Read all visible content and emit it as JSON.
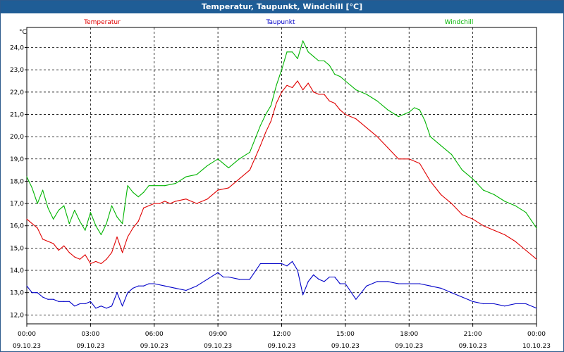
{
  "window": {
    "title": "Temperatur, Taupunkt, Windchill [°C]"
  },
  "chart_data": {
    "type": "line",
    "title": "Temperatur, Taupunkt, Windchill [°C]",
    "ylabel": "°C",
    "xlabel": "",
    "ylim": [
      11.6,
      24.9
    ],
    "y_ticks": [
      "12,0",
      "13,0",
      "14,0",
      "15,0",
      "16,0",
      "17,0",
      "18,0",
      "19,0",
      "20,0",
      "21,0",
      "22,0",
      "23,0",
      "24,0"
    ],
    "x_ticks": [
      {
        "time": "00:00",
        "date": "09.10.23"
      },
      {
        "time": "03:00",
        "date": "09.10.23"
      },
      {
        "time": "06:00",
        "date": "09.10.23"
      },
      {
        "time": "09:00",
        "date": "09.10.23"
      },
      {
        "time": "12:00",
        "date": "09.10.23"
      },
      {
        "time": "15:00",
        "date": "09.10.23"
      },
      {
        "time": "18:00",
        "date": "09.10.23"
      },
      {
        "time": "21:00",
        "date": "09.10.23"
      },
      {
        "time": "00:00",
        "date": "10.10.23"
      }
    ],
    "grid": true,
    "legend": "top",
    "x_unit": "hours",
    "series": [
      {
        "name": "Temperatur",
        "color": "#e00000",
        "x": [
          0,
          0.25,
          0.5,
          0.75,
          1,
          1.25,
          1.5,
          1.75,
          2,
          2.25,
          2.5,
          2.75,
          3,
          3.25,
          3.5,
          3.75,
          4,
          4.25,
          4.5,
          4.75,
          5,
          5.25,
          5.5,
          5.75,
          6,
          6.25,
          6.5,
          6.75,
          7,
          7.5,
          8,
          8.5,
          9,
          9.5,
          10,
          10.5,
          11,
          11.25,
          11.5,
          11.75,
          12,
          12.25,
          12.5,
          12.75,
          13,
          13.25,
          13.5,
          13.75,
          14,
          14.25,
          14.5,
          14.75,
          15,
          15.5,
          16,
          16.5,
          17,
          17.5,
          18,
          18.5,
          19,
          19.5,
          20,
          20.5,
          21,
          21.5,
          22,
          22.5,
          23,
          23.5,
          24
        ],
        "values": [
          16.3,
          16.1,
          15.9,
          15.4,
          15.3,
          15.2,
          14.9,
          15.1,
          14.8,
          14.6,
          14.5,
          14.7,
          14.3,
          14.4,
          14.3,
          14.5,
          14.8,
          15.5,
          14.8,
          15.5,
          15.9,
          16.2,
          16.8,
          16.9,
          17.0,
          17.0,
          17.1,
          17.0,
          17.1,
          17.2,
          17.0,
          17.2,
          17.6,
          17.7,
          18.1,
          18.5,
          19.6,
          20.2,
          20.7,
          21.5,
          22.0,
          22.3,
          22.2,
          22.5,
          22.1,
          22.4,
          22.0,
          21.9,
          21.9,
          21.6,
          21.5,
          21.2,
          21.0,
          20.8,
          20.4,
          20.0,
          19.5,
          19.0,
          19.0,
          18.8,
          18.0,
          17.4,
          17.0,
          16.5,
          16.3,
          16.0,
          15.8,
          15.6,
          15.3,
          14.9,
          14.5
        ]
      },
      {
        "name": "Taupunkt",
        "color": "#0000c8",
        "x": [
          0,
          0.25,
          0.5,
          0.75,
          1,
          1.25,
          1.5,
          1.75,
          2,
          2.25,
          2.5,
          2.75,
          3,
          3.25,
          3.5,
          3.75,
          4,
          4.25,
          4.5,
          4.75,
          5,
          5.25,
          5.5,
          5.75,
          6,
          6.5,
          7,
          7.5,
          8,
          8.5,
          9,
          9.25,
          9.5,
          10,
          10.5,
          11,
          11.5,
          12,
          12.25,
          12.5,
          12.75,
          13,
          13.25,
          13.5,
          13.75,
          14,
          14.25,
          14.5,
          14.75,
          15,
          15.5,
          16,
          16.5,
          17,
          17.5,
          18,
          18.5,
          19,
          19.5,
          20,
          20.5,
          21,
          21.5,
          22,
          22.5,
          23,
          23.5,
          24
        ],
        "values": [
          13.3,
          13.0,
          13.0,
          12.8,
          12.7,
          12.7,
          12.6,
          12.6,
          12.6,
          12.4,
          12.5,
          12.5,
          12.6,
          12.3,
          12.4,
          12.3,
          12.4,
          13.0,
          12.4,
          13.0,
          13.2,
          13.3,
          13.3,
          13.4,
          13.4,
          13.3,
          13.2,
          13.1,
          13.3,
          13.6,
          13.9,
          13.7,
          13.7,
          13.6,
          13.6,
          14.3,
          14.3,
          14.3,
          14.2,
          14.4,
          14.0,
          12.9,
          13.5,
          13.8,
          13.6,
          13.5,
          13.7,
          13.7,
          13.4,
          13.4,
          12.7,
          13.3,
          13.5,
          13.5,
          13.4,
          13.4,
          13.4,
          13.3,
          13.2,
          13.0,
          12.8,
          12.6,
          12.5,
          12.5,
          12.4,
          12.5,
          12.5,
          12.3
        ]
      },
      {
        "name": "Windchill",
        "color": "#00b400",
        "x": [
          0,
          0.25,
          0.5,
          0.75,
          1,
          1.25,
          1.5,
          1.75,
          2,
          2.25,
          2.5,
          2.75,
          3,
          3.25,
          3.5,
          3.75,
          4,
          4.25,
          4.5,
          4.75,
          5,
          5.25,
          5.5,
          5.75,
          6,
          6.5,
          7,
          7.5,
          8,
          8.5,
          9,
          9.5,
          10,
          10.5,
          11,
          11.25,
          11.5,
          11.75,
          12,
          12.25,
          12.5,
          12.75,
          13,
          13.25,
          13.5,
          13.75,
          14,
          14.25,
          14.5,
          14.75,
          15,
          15.5,
          16,
          16.5,
          17,
          17.5,
          18,
          18.25,
          18.5,
          18.75,
          19,
          19.5,
          20,
          20.5,
          21,
          21.5,
          22,
          22.5,
          23,
          23.5,
          24
        ],
        "values": [
          18.2,
          17.7,
          17.0,
          17.6,
          16.8,
          16.3,
          16.7,
          16.9,
          16.1,
          16.7,
          16.2,
          15.8,
          16.6,
          16.0,
          15.6,
          16.1,
          16.9,
          16.4,
          16.1,
          17.8,
          17.5,
          17.3,
          17.5,
          17.8,
          17.8,
          17.8,
          17.9,
          18.2,
          18.3,
          18.7,
          19.0,
          18.6,
          19.0,
          19.3,
          20.5,
          21.0,
          21.4,
          22.3,
          23.0,
          23.8,
          23.8,
          23.5,
          24.3,
          23.8,
          23.6,
          23.4,
          23.4,
          23.2,
          22.8,
          22.7,
          22.5,
          22.1,
          21.9,
          21.6,
          21.2,
          20.9,
          21.1,
          21.3,
          21.2,
          20.7,
          20.0,
          19.6,
          19.2,
          18.5,
          18.1,
          17.6,
          17.4,
          17.1,
          16.9,
          16.6,
          15.9
        ]
      }
    ]
  }
}
